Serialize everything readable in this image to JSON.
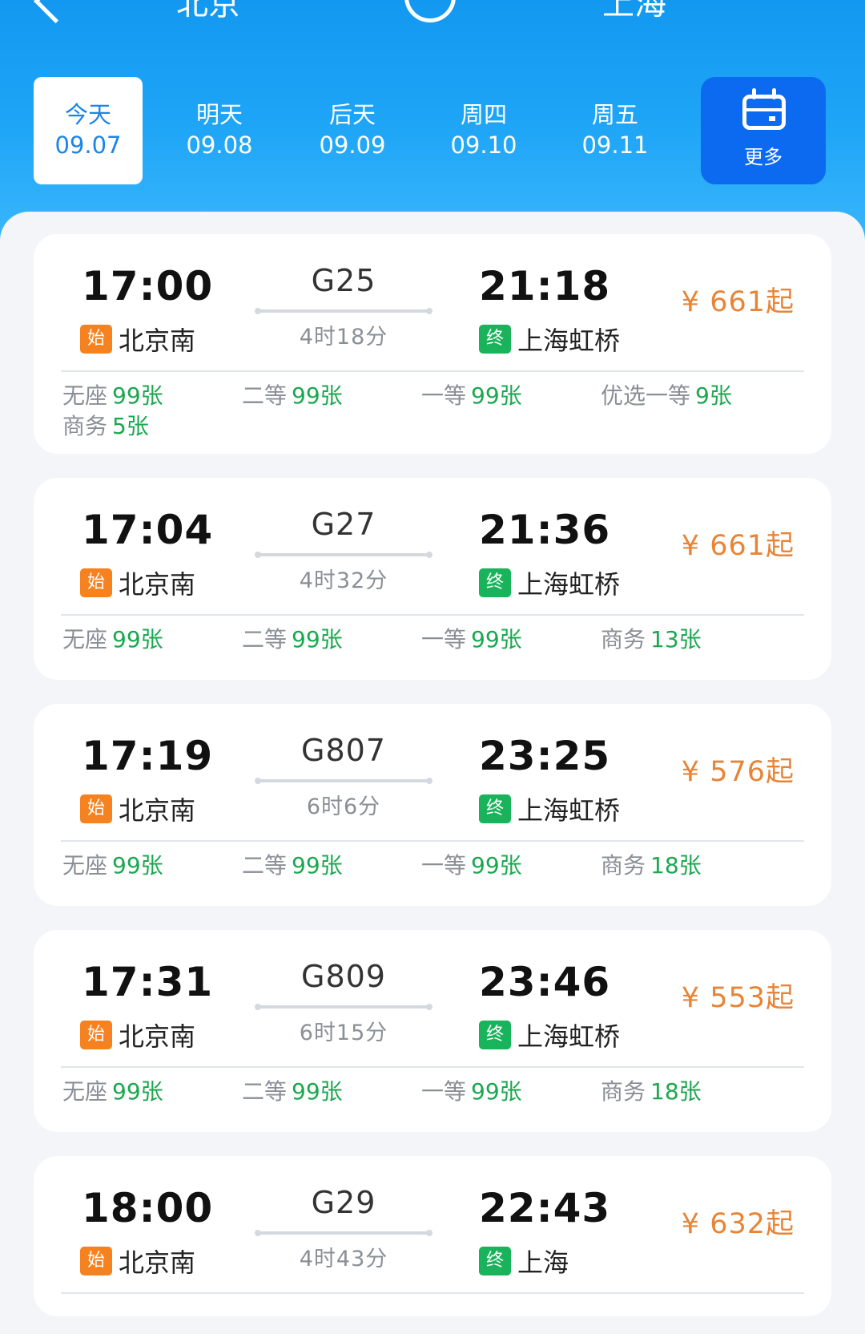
{
  "header": {
    "from_city": "北京",
    "to_city": "上海"
  },
  "dates": [
    {
      "day": "今天",
      "date": "09.07",
      "active": true
    },
    {
      "day": "明天",
      "date": "09.08"
    },
    {
      "day": "后天",
      "date": "09.09"
    },
    {
      "day": "周四",
      "date": "09.10"
    },
    {
      "day": "周五",
      "date": "09.11"
    }
  ],
  "more": {
    "label": "更多",
    "icon": "calendar-icon"
  },
  "colors": {
    "header_blue": "#1a9cf5",
    "price_orange": "#e88436",
    "seat_green": "#1aa84f",
    "start_tag": "#f6821f",
    "end_tag": "#18b35a"
  },
  "trains": [
    {
      "dep_time": "17:00",
      "dep_station": "北京南",
      "dep_tag": "始",
      "train_no": "G25",
      "duration": "4时18分",
      "arr_time": "21:18",
      "arr_station": "上海虹桥",
      "arr_tag": "终",
      "price": "¥ 661起",
      "seats": [
        {
          "type": "无座",
          "count": "99张"
        },
        {
          "type": "二等",
          "count": "99张"
        },
        {
          "type": "一等",
          "count": "99张"
        },
        {
          "type": "优选一等",
          "count": "9张"
        },
        {
          "type": "商务",
          "count": "5张"
        }
      ]
    },
    {
      "dep_time": "17:04",
      "dep_station": "北京南",
      "dep_tag": "始",
      "train_no": "G27",
      "duration": "4时32分",
      "arr_time": "21:36",
      "arr_station": "上海虹桥",
      "arr_tag": "终",
      "price": "¥ 661起",
      "seats": [
        {
          "type": "无座",
          "count": "99张"
        },
        {
          "type": "二等",
          "count": "99张"
        },
        {
          "type": "一等",
          "count": "99张"
        },
        {
          "type": "商务",
          "count": "13张"
        }
      ]
    },
    {
      "dep_time": "17:19",
      "dep_station": "北京南",
      "dep_tag": "始",
      "train_no": "G807",
      "duration": "6时6分",
      "arr_time": "23:25",
      "arr_station": "上海虹桥",
      "arr_tag": "终",
      "price": "¥ 576起",
      "seats": [
        {
          "type": "无座",
          "count": "99张"
        },
        {
          "type": "二等",
          "count": "99张"
        },
        {
          "type": "一等",
          "count": "99张"
        },
        {
          "type": "商务",
          "count": "18张"
        }
      ]
    },
    {
      "dep_time": "17:31",
      "dep_station": "北京南",
      "dep_tag": "始",
      "train_no": "G809",
      "duration": "6时15分",
      "arr_time": "23:46",
      "arr_station": "上海虹桥",
      "arr_tag": "终",
      "price": "¥ 553起",
      "seats": [
        {
          "type": "无座",
          "count": "99张"
        },
        {
          "type": "二等",
          "count": "99张"
        },
        {
          "type": "一等",
          "count": "99张"
        },
        {
          "type": "商务",
          "count": "18张"
        }
      ]
    },
    {
      "dep_time": "18:00",
      "dep_station": "北京南",
      "dep_tag": "始",
      "train_no": "G29",
      "duration": "4时43分",
      "arr_time": "22:43",
      "arr_station": "上海",
      "arr_tag": "终",
      "price": "¥ 632起",
      "seats": []
    }
  ]
}
